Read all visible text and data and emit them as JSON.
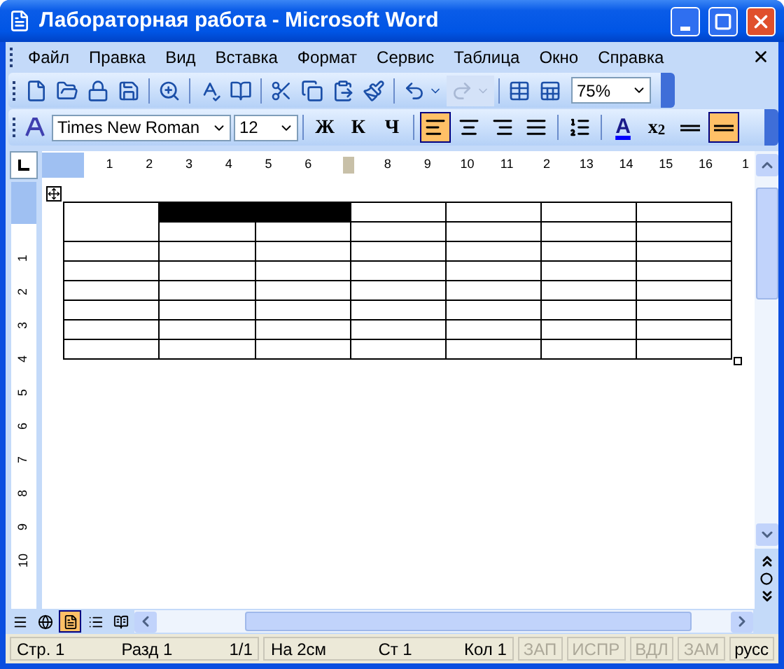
{
  "window": {
    "title": "Лабораторная работа - Microsoft Word"
  },
  "menu": [
    "Файл",
    "Правка",
    "Вид",
    "Вставка",
    "Формат",
    "Сервис",
    "Таблица",
    "Окно",
    "Справка"
  ],
  "standard_toolbar": {
    "groups": [
      [
        {
          "kind": "new",
          "disabled": false
        },
        {
          "kind": "open",
          "disabled": false
        },
        {
          "kind": "permission",
          "disabled": false
        },
        {
          "kind": "save",
          "disabled": false
        }
      ],
      [
        {
          "kind": "preview",
          "disabled": false
        }
      ],
      [
        {
          "kind": "spelling",
          "disabled": false
        },
        {
          "kind": "research",
          "disabled": false
        }
      ],
      [
        {
          "kind": "cut",
          "disabled": false
        },
        {
          "kind": "copy",
          "disabled": false
        },
        {
          "kind": "paste",
          "disabled": false
        },
        {
          "kind": "painter",
          "disabled": false
        }
      ],
      [
        {
          "kind": "undo",
          "disabled": false
        },
        {
          "kind": "redo",
          "disabled": true
        }
      ],
      [
        {
          "kind": "tables",
          "disabled": false
        },
        {
          "kind": "excel",
          "disabled": false
        }
      ]
    ],
    "zoom": "75%"
  },
  "formatting_toolbar": {
    "font": "Times New Roman",
    "size": "12",
    "groups": [
      [
        {
          "kind": "text",
          "label": "Ж",
          "selected": false
        },
        {
          "kind": "text",
          "label": "К",
          "selected": false
        },
        {
          "kind": "text",
          "label": "Ч",
          "selected": false
        }
      ],
      [
        {
          "kind": "align-left",
          "selected": true
        },
        {
          "kind": "align-center",
          "selected": false
        },
        {
          "kind": "align-right",
          "selected": false
        },
        {
          "kind": "justify",
          "selected": false
        }
      ],
      [
        {
          "kind": "numbering",
          "selected": false
        }
      ],
      [
        {
          "kind": "font-color",
          "label": "A",
          "selected": false
        },
        {
          "kind": "text",
          "label": "x$_{2}$",
          "selected": false
        },
        {
          "kind": "border",
          "selected": false
        },
        {
          "kind": "border",
          "selected": true
        }
      ]
    ]
  },
  "ruler": {
    "marks": [
      {
        "kind": "number",
        "text": "1"
      },
      {
        "kind": "number",
        "text": "2"
      },
      {
        "kind": "number",
        "text": "3"
      },
      {
        "kind": "number",
        "text": "4"
      },
      {
        "kind": "number",
        "text": "5"
      },
      {
        "kind": "number",
        "text": "6"
      },
      {
        "kind": "marker"
      },
      {
        "kind": "number",
        "text": "8"
      },
      {
        "kind": "number",
        "text": "9"
      },
      {
        "kind": "number",
        "text": "10"
      },
      {
        "kind": "number",
        "text": "11"
      },
      {
        "kind": "number",
        "text": "2"
      },
      {
        "kind": "number",
        "text": "13"
      },
      {
        "kind": "number",
        "text": "14"
      },
      {
        "kind": "number",
        "text": "15"
      },
      {
        "kind": "number",
        "text": "16"
      },
      {
        "kind": "number",
        "text": "1"
      }
    ]
  },
  "vertical_ruler": {
    "labels": [
      "1",
      "2",
      "3",
      "4",
      "5",
      "6",
      "7",
      "8",
      "9",
      "10"
    ]
  },
  "table": {
    "rows": [
      [
        {
          "kind": "tall",
          "selected": false
        },
        {
          "kind": "wide",
          "selected": true
        },
        {
          "kind": "plain",
          "selected": false
        },
        {
          "kind": "plain",
          "selected": false
        },
        {
          "kind": "plain",
          "selected": false
        },
        {
          "kind": "plain",
          "selected": false
        }
      ],
      [
        {
          "kind": "plain",
          "selected": false
        },
        {
          "kind": "plain",
          "selected": false
        },
        {
          "kind": "plain",
          "selected": false
        },
        {
          "kind": "plain",
          "selected": false
        },
        {
          "kind": "plain",
          "selected": false
        },
        {
          "kind": "plain",
          "selected": false
        }
      ],
      [
        {
          "kind": "plain",
          "selected": false
        },
        {
          "kind": "plain",
          "selected": false
        },
        {
          "kind": "plain",
          "selected": false
        },
        {
          "kind": "plain",
          "selected": false
        },
        {
          "kind": "plain",
          "selected": false
        },
        {
          "kind": "plain",
          "selected": false
        },
        {
          "kind": "plain",
          "selected": false
        }
      ],
      [
        {
          "kind": "plain",
          "selected": false
        },
        {
          "kind": "plain",
          "selected": false
        },
        {
          "kind": "plain",
          "selected": false
        },
        {
          "kind": "plain",
          "selected": false
        },
        {
          "kind": "plain",
          "selected": false
        },
        {
          "kind": "plain",
          "selected": false
        },
        {
          "kind": "plain",
          "selected": false
        }
      ],
      [
        {
          "kind": "plain",
          "selected": false
        },
        {
          "kind": "plain",
          "selected": false
        },
        {
          "kind": "plain",
          "selected": false
        },
        {
          "kind": "plain",
          "selected": false
        },
        {
          "kind": "plain",
          "selected": false
        },
        {
          "kind": "plain",
          "selected": false
        },
        {
          "kind": "plain",
          "selected": false
        }
      ],
      [
        {
          "kind": "plain",
          "selected": false
        },
        {
          "kind": "plain",
          "selected": false
        },
        {
          "kind": "plain",
          "selected": false
        },
        {
          "kind": "plain",
          "selected": false
        },
        {
          "kind": "plain",
          "selected": false
        },
        {
          "kind": "plain",
          "selected": false
        },
        {
          "kind": "plain",
          "selected": false
        }
      ],
      [
        {
          "kind": "plain",
          "selected": false
        },
        {
          "kind": "plain",
          "selected": false
        },
        {
          "kind": "plain",
          "selected": false
        },
        {
          "kind": "plain",
          "selected": false
        },
        {
          "kind": "plain",
          "selected": false
        },
        {
          "kind": "plain",
          "selected": false
        },
        {
          "kind": "plain",
          "selected": false
        }
      ],
      [
        {
          "kind": "plain",
          "selected": false
        },
        {
          "kind": "plain",
          "selected": false
        },
        {
          "kind": "plain",
          "selected": false
        },
        {
          "kind": "plain",
          "selected": false
        },
        {
          "kind": "plain",
          "selected": false
        },
        {
          "kind": "plain",
          "selected": false
        },
        {
          "kind": "plain",
          "selected": false
        }
      ]
    ]
  },
  "views": [
    {
      "kind": "normal",
      "selected": false
    },
    {
      "kind": "web",
      "selected": false
    },
    {
      "kind": "print",
      "selected": true
    },
    {
      "kind": "outline",
      "selected": false
    },
    {
      "kind": "reading",
      "selected": false
    }
  ],
  "status_bar": {
    "sections": [
      [
        {
          "text": "Стр. 1",
          "disabled": false
        },
        {
          "text": "Разд 1",
          "disabled": false
        },
        {
          "text": "1/1",
          "disabled": false
        }
      ],
      [
        {
          "text": "На 2см",
          "disabled": false
        },
        {
          "text": "Ст 1",
          "disabled": false
        },
        {
          "text": "Кол 1",
          "disabled": false
        }
      ],
      [
        {
          "text": "ЗАП",
          "disabled": true
        }
      ],
      [
        {
          "text": "ИСПР",
          "disabled": true
        }
      ],
      [
        {
          "text": "ВДЛ",
          "disabled": true
        }
      ],
      [
        {
          "text": "ЗАМ",
          "disabled": true
        }
      ],
      [
        {
          "text": "русс",
          "disabled": false
        }
      ]
    ]
  }
}
